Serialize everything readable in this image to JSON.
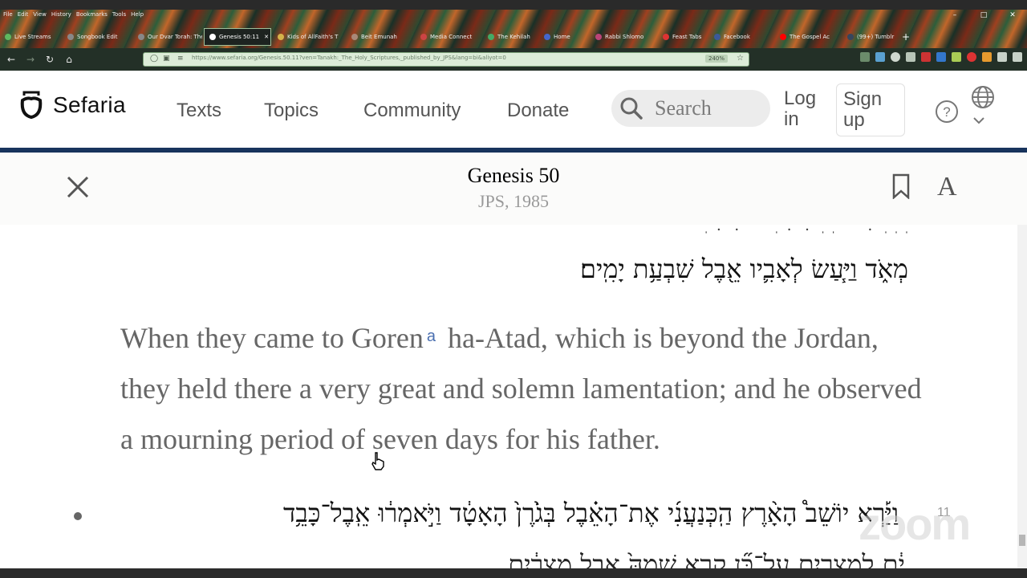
{
  "browser": {
    "menu": [
      "File",
      "Edit",
      "View",
      "History",
      "Bookmarks",
      "Tools",
      "Help"
    ],
    "tabs": [
      {
        "label": "Live Streams",
        "active": false
      },
      {
        "label": "Songbook Edit",
        "active": false
      },
      {
        "label": "Our Dvar Torah: The",
        "active": false
      },
      {
        "label": "Genesis 50:11",
        "active": true
      },
      {
        "label": "Kids of AllFaith's T",
        "active": false
      },
      {
        "label": "Beit Emunah",
        "active": false
      },
      {
        "label": "Media Connect",
        "active": false
      },
      {
        "label": "The Kehilah",
        "active": false
      },
      {
        "label": "Home",
        "active": false
      },
      {
        "label": "Rabbi Shlomo",
        "active": false
      },
      {
        "label": "Feast Tabs",
        "active": false
      },
      {
        "label": "Facebook",
        "active": false
      },
      {
        "label": "The Gospel Ac",
        "active": false
      },
      {
        "label": "(99+) Tumblr",
        "active": false
      }
    ],
    "url": "https://www.sefaria.org/Genesis.50.11?ven=Tanakh:_The_Holy_Scriptures,_published_by_JPS&lang=bi&aliyot=0",
    "zoom": "240%"
  },
  "header": {
    "logo_text": "Sefaria",
    "nav": {
      "texts": "Texts",
      "topics": "Topics",
      "community": "Community",
      "donate": "Donate"
    },
    "search_placeholder": "Search",
    "login_line1": "Log",
    "login_line2": "in",
    "signup_line1": "Sign",
    "signup_line2": "up"
  },
  "reader": {
    "title": "Genesis 50",
    "subtitle": "JPS, 1985"
  },
  "content": {
    "hebrew_prev_end": "מְאֹ֑ד וַיַּ֧עַשׂ לְאָבִ֛יו אֵ֖בֶל שִׁבְעַ֥ת יָמִֽים׃",
    "english_part1": "When they came to Goren",
    "footnote_marker": "a",
    "english_part2": " ha-Atad, which is beyond the Jordan, they held there a very great and solemn lamentation; and he observed a mourning period of seven days for his father.",
    "hebrew_verse_line1": "וַיַּ֡רְא יוֹשֵׁב֩ הָאָ֨רֶץ הַֽכְּנַעֲנִ֜י אֶת־הָאֵ֗בֶל בְּגֹ֙רֶן֙ הָאָטָ֔ד וַיֹּ֣אמְר֔וּ אֵֽבֶל־כָּבֵ֥ד",
    "verse_number": "11",
    "watermark": "zoom"
  }
}
